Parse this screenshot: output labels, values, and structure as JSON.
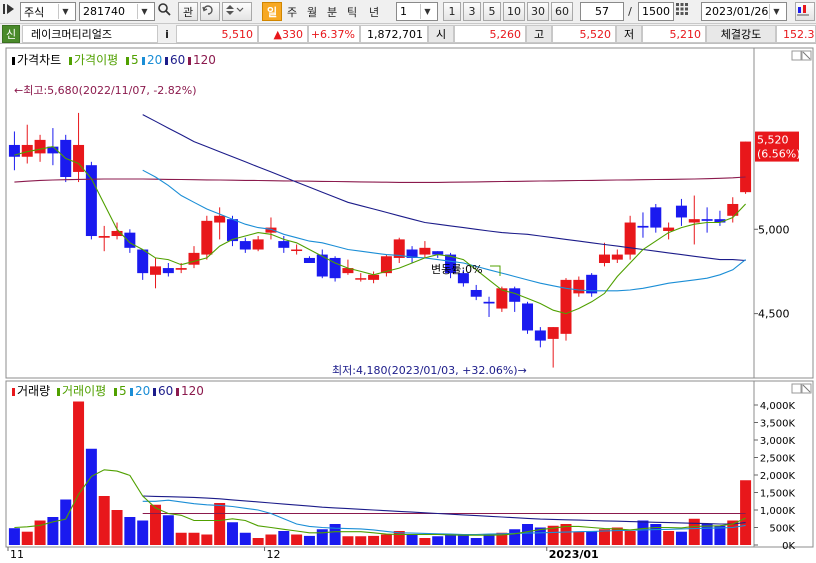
{
  "toolbar": {
    "market_type": "주식",
    "stock_code": "281740",
    "search_icon": "search-icon",
    "watch_label": "관",
    "period_active": "일",
    "periods": [
      "주",
      "월",
      "분",
      "틱",
      "년"
    ],
    "interval_value": "1",
    "interval_options": [
      "1",
      "3",
      "5",
      "10",
      "30",
      "60"
    ],
    "count_value": "57",
    "slash": "/",
    "count_total": "1500",
    "date_value": "2023/01/26"
  },
  "infobar": {
    "credit_label": "신",
    "stock_name": "레이크머티리얼즈",
    "info_label": "i",
    "price": "5,510",
    "change": "▲330",
    "change_pct": "+6.37%",
    "volume": "1,872,701",
    "open_label": "시",
    "open": "5,260",
    "high_label": "고",
    "high": "5,520",
    "low_label": "저",
    "low": "5,210",
    "strength_label": "체결강도",
    "strength": "152.3"
  },
  "colors": {
    "up": "#e8171b",
    "down": "#1a1aef",
    "ma5": "#50a000",
    "ma20": "#1b8ed6",
    "ma60": "#1c1c8a",
    "ma120": "#8b1a4d",
    "accent": "#f7a823"
  },
  "chart_data": [
    {
      "type": "candlestick",
      "title": "가격차트",
      "legend": [
        {
          "label": "가격이평",
          "color": "#50a000"
        },
        {
          "label": "5",
          "color": "#50a000"
        },
        {
          "label": "20",
          "color": "#1b8ed6"
        },
        {
          "label": "60",
          "color": "#1c1c8a"
        },
        {
          "label": "120",
          "color": "#8b1a4d"
        }
      ],
      "ylim": [
        4130,
        5980
      ],
      "y_ticks": [
        {
          "v": 5000,
          "label": "5,000"
        },
        {
          "v": 4500,
          "label": "4,500"
        }
      ],
      "x_labels": [
        {
          "i": 0,
          "label": "11"
        },
        {
          "i": 20,
          "label": "12"
        },
        {
          "i": 42,
          "label": "2023/01"
        }
      ],
      "current_price": "5,520",
      "current_pct": "(6.56%)",
      "high_annotation": "←최고:5,680(2022/11/07, -2.82%)",
      "low_annotation": "최저:4,180(2023/01/03, +32.06%)→",
      "volatility_annotation": "변동률:0%",
      "candles": [
        [
          5500,
          5430,
          5580,
          5350
        ],
        [
          5430,
          5500,
          5620,
          5390
        ],
        [
          5450,
          5530,
          5560,
          5400
        ],
        [
          5490,
          5450,
          5600,
          5380
        ],
        [
          5530,
          5310,
          5560,
          5280
        ],
        [
          5340,
          5500,
          5690,
          5280
        ],
        [
          5380,
          4960,
          5400,
          4940
        ],
        [
          4950,
          4960,
          5020,
          4870
        ],
        [
          4960,
          4990,
          5040,
          4940
        ],
        [
          4980,
          4890,
          5000,
          4860
        ],
        [
          4880,
          4740,
          4880,
          4700
        ],
        [
          4730,
          4780,
          4830,
          4650
        ],
        [
          4770,
          4740,
          4800,
          4720
        ],
        [
          4760,
          4770,
          4800,
          4740
        ],
        [
          4790,
          4860,
          4900,
          4770
        ],
        [
          4850,
          5050,
          5080,
          4820
        ],
        [
          5040,
          5080,
          5130,
          4940
        ],
        [
          5060,
          4930,
          5080,
          4900
        ],
        [
          4930,
          4880,
          4950,
          4860
        ],
        [
          4880,
          4940,
          4960,
          4870
        ],
        [
          4980,
          5010,
          5070,
          4940
        ],
        [
          4930,
          4890,
          4960,
          4860
        ],
        [
          4880,
          4880,
          4910,
          4850
        ],
        [
          4830,
          4800,
          4840,
          4800
        ],
        [
          4850,
          4720,
          4880,
          4710
        ],
        [
          4830,
          4710,
          4840,
          4690
        ],
        [
          4740,
          4770,
          4820,
          4730
        ],
        [
          4710,
          4710,
          4740,
          4690
        ],
        [
          4700,
          4730,
          4750,
          4680
        ],
        [
          4740,
          4840,
          4850,
          4720
        ],
        [
          4830,
          4940,
          4950,
          4800
        ],
        [
          4880,
          4830,
          4900,
          4800
        ],
        [
          4850,
          4890,
          4930,
          4830
        ],
        [
          4870,
          4850,
          4870,
          4830
        ],
        [
          4850,
          4740,
          4860,
          4710
        ],
        [
          4740,
          4680,
          4760,
          4660
        ],
        [
          4640,
          4600,
          4670,
          4580
        ],
        [
          4570,
          4560,
          4600,
          4480
        ],
        [
          4530,
          4650,
          4660,
          4510
        ],
        [
          4650,
          4570,
          4660,
          4510
        ],
        [
          4560,
          4400,
          4570,
          4380
        ],
        [
          4400,
          4340,
          4420,
          4300
        ],
        [
          4350,
          4420,
          4420,
          4180
        ],
        [
          4380,
          4700,
          4710,
          4340
        ],
        [
          4620,
          4700,
          4720,
          4600
        ],
        [
          4730,
          4620,
          4740,
          4600
        ],
        [
          4800,
          4850,
          4920,
          4780
        ],
        [
          4820,
          4850,
          4880,
          4800
        ],
        [
          4850,
          5040,
          5080,
          4820
        ],
        [
          5020,
          5010,
          5100,
          4950
        ],
        [
          5130,
          5010,
          5150,
          4980
        ],
        [
          4990,
          5010,
          5040,
          4940
        ],
        [
          5140,
          5070,
          5180,
          5020
        ],
        [
          5040,
          5060,
          5200,
          4910
        ],
        [
          5060,
          5050,
          5130,
          4980
        ],
        [
          5060,
          5040,
          5110,
          5020
        ],
        [
          5080,
          5150,
          5190,
          5040
        ],
        [
          5220,
          5520,
          5520,
          5210
        ]
      ],
      "ma5": [
        5440,
        5460,
        5475,
        5490,
        5420,
        5390,
        5300,
        5150,
        5000,
        4920,
        4880,
        4830,
        4820,
        4790,
        4810,
        4830,
        4900,
        4940,
        4960,
        4980,
        4970,
        4940,
        4920,
        4880,
        4840,
        4800,
        4770,
        4750,
        4730,
        4750,
        4770,
        4800,
        4830,
        4850,
        4840,
        4820,
        4760,
        4700,
        4640,
        4620,
        4590,
        4560,
        4520,
        4500,
        4530,
        4570,
        4620,
        4720,
        4800,
        4880,
        4930,
        4980,
        5010,
        5030,
        5040,
        5040,
        5070,
        5150
      ],
      "ma20": [
        null,
        null,
        null,
        null,
        null,
        null,
        null,
        null,
        null,
        null,
        5350,
        5310,
        5260,
        5200,
        5160,
        5120,
        5090,
        5060,
        5030,
        5010,
        5000,
        4970,
        4950,
        4930,
        4920,
        4900,
        4880,
        4870,
        4860,
        4850,
        4845,
        4835,
        4830,
        4820,
        4810,
        4800,
        4780,
        4760,
        4740,
        4720,
        4700,
        4680,
        4665,
        4650,
        4640,
        4635,
        4635,
        4635,
        4640,
        4650,
        4665,
        4680,
        4690,
        4700,
        4710,
        4730,
        4760,
        4820
      ],
      "ma60": [
        null,
        null,
        null,
        null,
        null,
        null,
        null,
        null,
        null,
        null,
        5680,
        5640,
        5600,
        5560,
        5520,
        5490,
        5460,
        5430,
        5400,
        5370,
        5340,
        5310,
        5280,
        5250,
        5220,
        5190,
        5160,
        5140,
        5120,
        5100,
        5080,
        5060,
        5040,
        5030,
        5020,
        5010,
        5000,
        4990,
        4980,
        4975,
        4970,
        4960,
        4950,
        4940,
        4930,
        4920,
        4910,
        4900,
        4890,
        4880,
        4870,
        4860,
        4850,
        4840,
        4830,
        4820,
        4820,
        4815
      ],
      "ma120": [
        5280,
        5285,
        5290,
        5292,
        5294,
        5296,
        5297,
        5298,
        5298,
        5298,
        5298,
        5297,
        5296,
        5295,
        5294,
        5293,
        5292,
        5291,
        5290,
        5289,
        5288,
        5287,
        5286,
        5285,
        5284,
        5283,
        5282,
        5281,
        5280,
        5279,
        5278,
        5278,
        5278,
        5278,
        5279,
        5280,
        5281,
        5282,
        5283,
        5284,
        5285,
        5286,
        5287,
        5288,
        5289,
        5290,
        5291,
        5292,
        5293,
        5294,
        5295,
        5296,
        5297,
        5298,
        5300,
        5302,
        5305,
        5310
      ]
    },
    {
      "type": "bar",
      "title": "거래량",
      "legend": [
        {
          "label": "거래이평",
          "color": "#50a000"
        },
        {
          "label": "5",
          "color": "#50a000"
        },
        {
          "label": "20",
          "color": "#1b8ed6"
        },
        {
          "label": "60",
          "color": "#1c1c8a"
        },
        {
          "label": "120",
          "color": "#8b1a4d"
        }
      ],
      "ylim": [
        0,
        4200000
      ],
      "y_ticks": [
        {
          "v": 4000000,
          "label": "4,000K"
        },
        {
          "v": 3500000,
          "label": "3,500K"
        },
        {
          "v": 3000000,
          "label": "3,000K"
        },
        {
          "v": 2500000,
          "label": "2,500K"
        },
        {
          "v": 2000000,
          "label": "2,000K"
        },
        {
          "v": 1500000,
          "label": "1,500K"
        },
        {
          "v": 1000000,
          "label": "1,000K"
        },
        {
          "v": 500000,
          "label": "500K"
        },
        {
          "v": 0,
          "label": "0K"
        }
      ],
      "volumes": [
        480000,
        380000,
        700000,
        800000,
        1300000,
        4100000,
        2750000,
        1400000,
        1000000,
        800000,
        700000,
        1150000,
        850000,
        350000,
        350000,
        300000,
        1200000,
        650000,
        350000,
        200000,
        300000,
        400000,
        300000,
        260000,
        450000,
        600000,
        250000,
        250000,
        260000,
        300000,
        400000,
        300000,
        200000,
        250000,
        300000,
        300000,
        200000,
        300000,
        350000,
        450000,
        600000,
        500000,
        550000,
        600000,
        380000,
        400000,
        450000,
        500000,
        400000,
        700000,
        600000,
        400000,
        380000,
        750000,
        600000,
        550000,
        700000,
        1850000
      ],
      "vol_ma5": [
        500000,
        520000,
        560000,
        660000,
        740000,
        1450000,
        1960000,
        2150000,
        2110000,
        1990000,
        1400000,
        1060000,
        900000,
        850000,
        700000,
        700000,
        700000,
        750000,
        700000,
        550000,
        500000,
        450000,
        400000,
        350000,
        350000,
        380000,
        380000,
        380000,
        350000,
        310000,
        300000,
        300000,
        300000,
        300000,
        290000,
        280000,
        280000,
        280000,
        290000,
        320000,
        380000,
        440000,
        480000,
        530000,
        530000,
        500000,
        470000,
        460000,
        430000,
        470000,
        500000,
        500000,
        490000,
        530000,
        540000,
        550000,
        600000,
        770000
      ],
      "vol_ma20": [
        null,
        null,
        null,
        null,
        null,
        null,
        null,
        null,
        null,
        null,
        1250000,
        1250000,
        1280000,
        1230000,
        1180000,
        1150000,
        1130000,
        1100000,
        1050000,
        1000000,
        900000,
        750000,
        600000,
        530000,
        500000,
        480000,
        470000,
        460000,
        430000,
        390000,
        350000,
        340000,
        330000,
        320000,
        310000,
        300000,
        300000,
        310000,
        320000,
        330000,
        340000,
        350000,
        360000,
        370000,
        380000,
        390000,
        400000,
        410000,
        420000,
        430000,
        440000,
        450000,
        460000,
        470000,
        480000,
        490000,
        500000,
        560000
      ],
      "vol_ma60": [
        null,
        null,
        null,
        null,
        null,
        null,
        null,
        null,
        null,
        null,
        1400000,
        1390000,
        1380000,
        1370000,
        1360000,
        1340000,
        1320000,
        1290000,
        1260000,
        1230000,
        1200000,
        1170000,
        1140000,
        1110000,
        1080000,
        1060000,
        1040000,
        1020000,
        1000000,
        980000,
        960000,
        940000,
        920000,
        900000,
        880000,
        860000,
        840000,
        820000,
        800000,
        780000,
        760000,
        740000,
        730000,
        720000,
        710000,
        700000,
        690000,
        680000,
        670000,
        660000,
        650000,
        640000,
        630000,
        620000,
        610000,
        600000,
        600000,
        640000
      ],
      "vol_ma120": [
        null,
        null,
        null,
        null,
        null,
        null,
        null,
        null,
        null,
        null,
        900000,
        900000,
        900000,
        900000,
        900000,
        900000,
        900000,
        900000,
        900000,
        900000,
        900000,
        900000,
        900000,
        900000,
        900000,
        900000,
        900000,
        900000,
        900000,
        900000,
        900000,
        900000,
        900000,
        900000,
        900000,
        900000,
        900000,
        900000,
        900000,
        900000,
        900000,
        900000,
        900000,
        900000,
        900000,
        900000,
        900000,
        900000,
        900000,
        900000,
        900000,
        900000,
        900000,
        900000,
        900000,
        900000,
        900000,
        900000
      ]
    }
  ]
}
